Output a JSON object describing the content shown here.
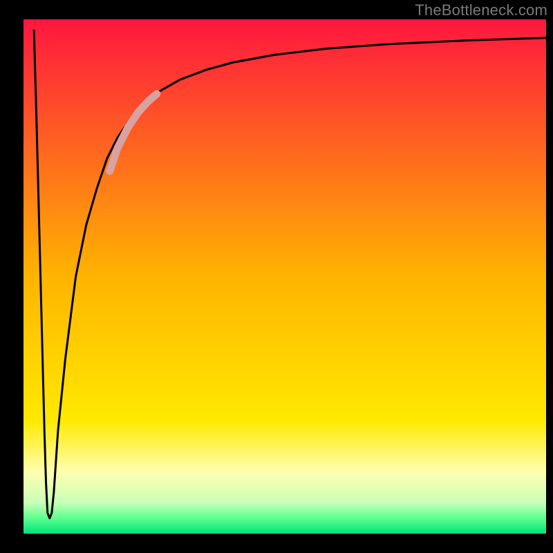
{
  "watermark": "TheBottleneck.com",
  "chart_data": {
    "type": "line",
    "title": "",
    "xlabel": "",
    "ylabel": "",
    "xlim": [
      0,
      100
    ],
    "ylim": [
      0,
      100
    ],
    "grid": false,
    "legend": false,
    "background_gradient": {
      "stops": [
        {
          "offset": 0.0,
          "color": "#ff163f"
        },
        {
          "offset": 0.5,
          "color": "#ffb400"
        },
        {
          "offset": 0.78,
          "color": "#ffe900"
        },
        {
          "offset": 0.88,
          "color": "#ffffb0"
        },
        {
          "offset": 0.94,
          "color": "#c8ffb8"
        },
        {
          "offset": 0.97,
          "color": "#5cff8f"
        },
        {
          "offset": 1.0,
          "color": "#00e27a"
        }
      ]
    },
    "series": [
      {
        "name": "sharp-dip",
        "x": [
          2.0,
          2.5,
          3.0,
          3.5,
          4.0,
          4.3,
          4.6,
          5.0,
          5.4,
          5.8,
          6.2,
          6.6
        ],
        "y": [
          98,
          80,
          60,
          40,
          20,
          10,
          4,
          3,
          4,
          8,
          14,
          20
        ],
        "stroke": "#000000",
        "stroke_width": 3
      },
      {
        "name": "recovery-curve",
        "x": [
          6.6,
          8,
          10,
          12,
          14,
          16,
          18,
          20,
          23,
          26,
          30,
          35,
          40,
          48,
          58,
          70,
          85,
          100
        ],
        "y": [
          20,
          34,
          50,
          60,
          67,
          73,
          77,
          80,
          83.5,
          86,
          88.3,
          90.2,
          91.6,
          93.1,
          94.3,
          95.2,
          95.9,
          96.4
        ],
        "stroke": "#000000",
        "stroke_width": 3
      },
      {
        "name": "highlight-segment",
        "x": [
          16.5,
          18,
          20,
          22,
          24,
          25.5
        ],
        "y": [
          70.5,
          75,
          79,
          82,
          84.2,
          85.5
        ],
        "stroke": "#d8a2a0",
        "stroke_width": 11,
        "linecap": "round"
      }
    ]
  }
}
